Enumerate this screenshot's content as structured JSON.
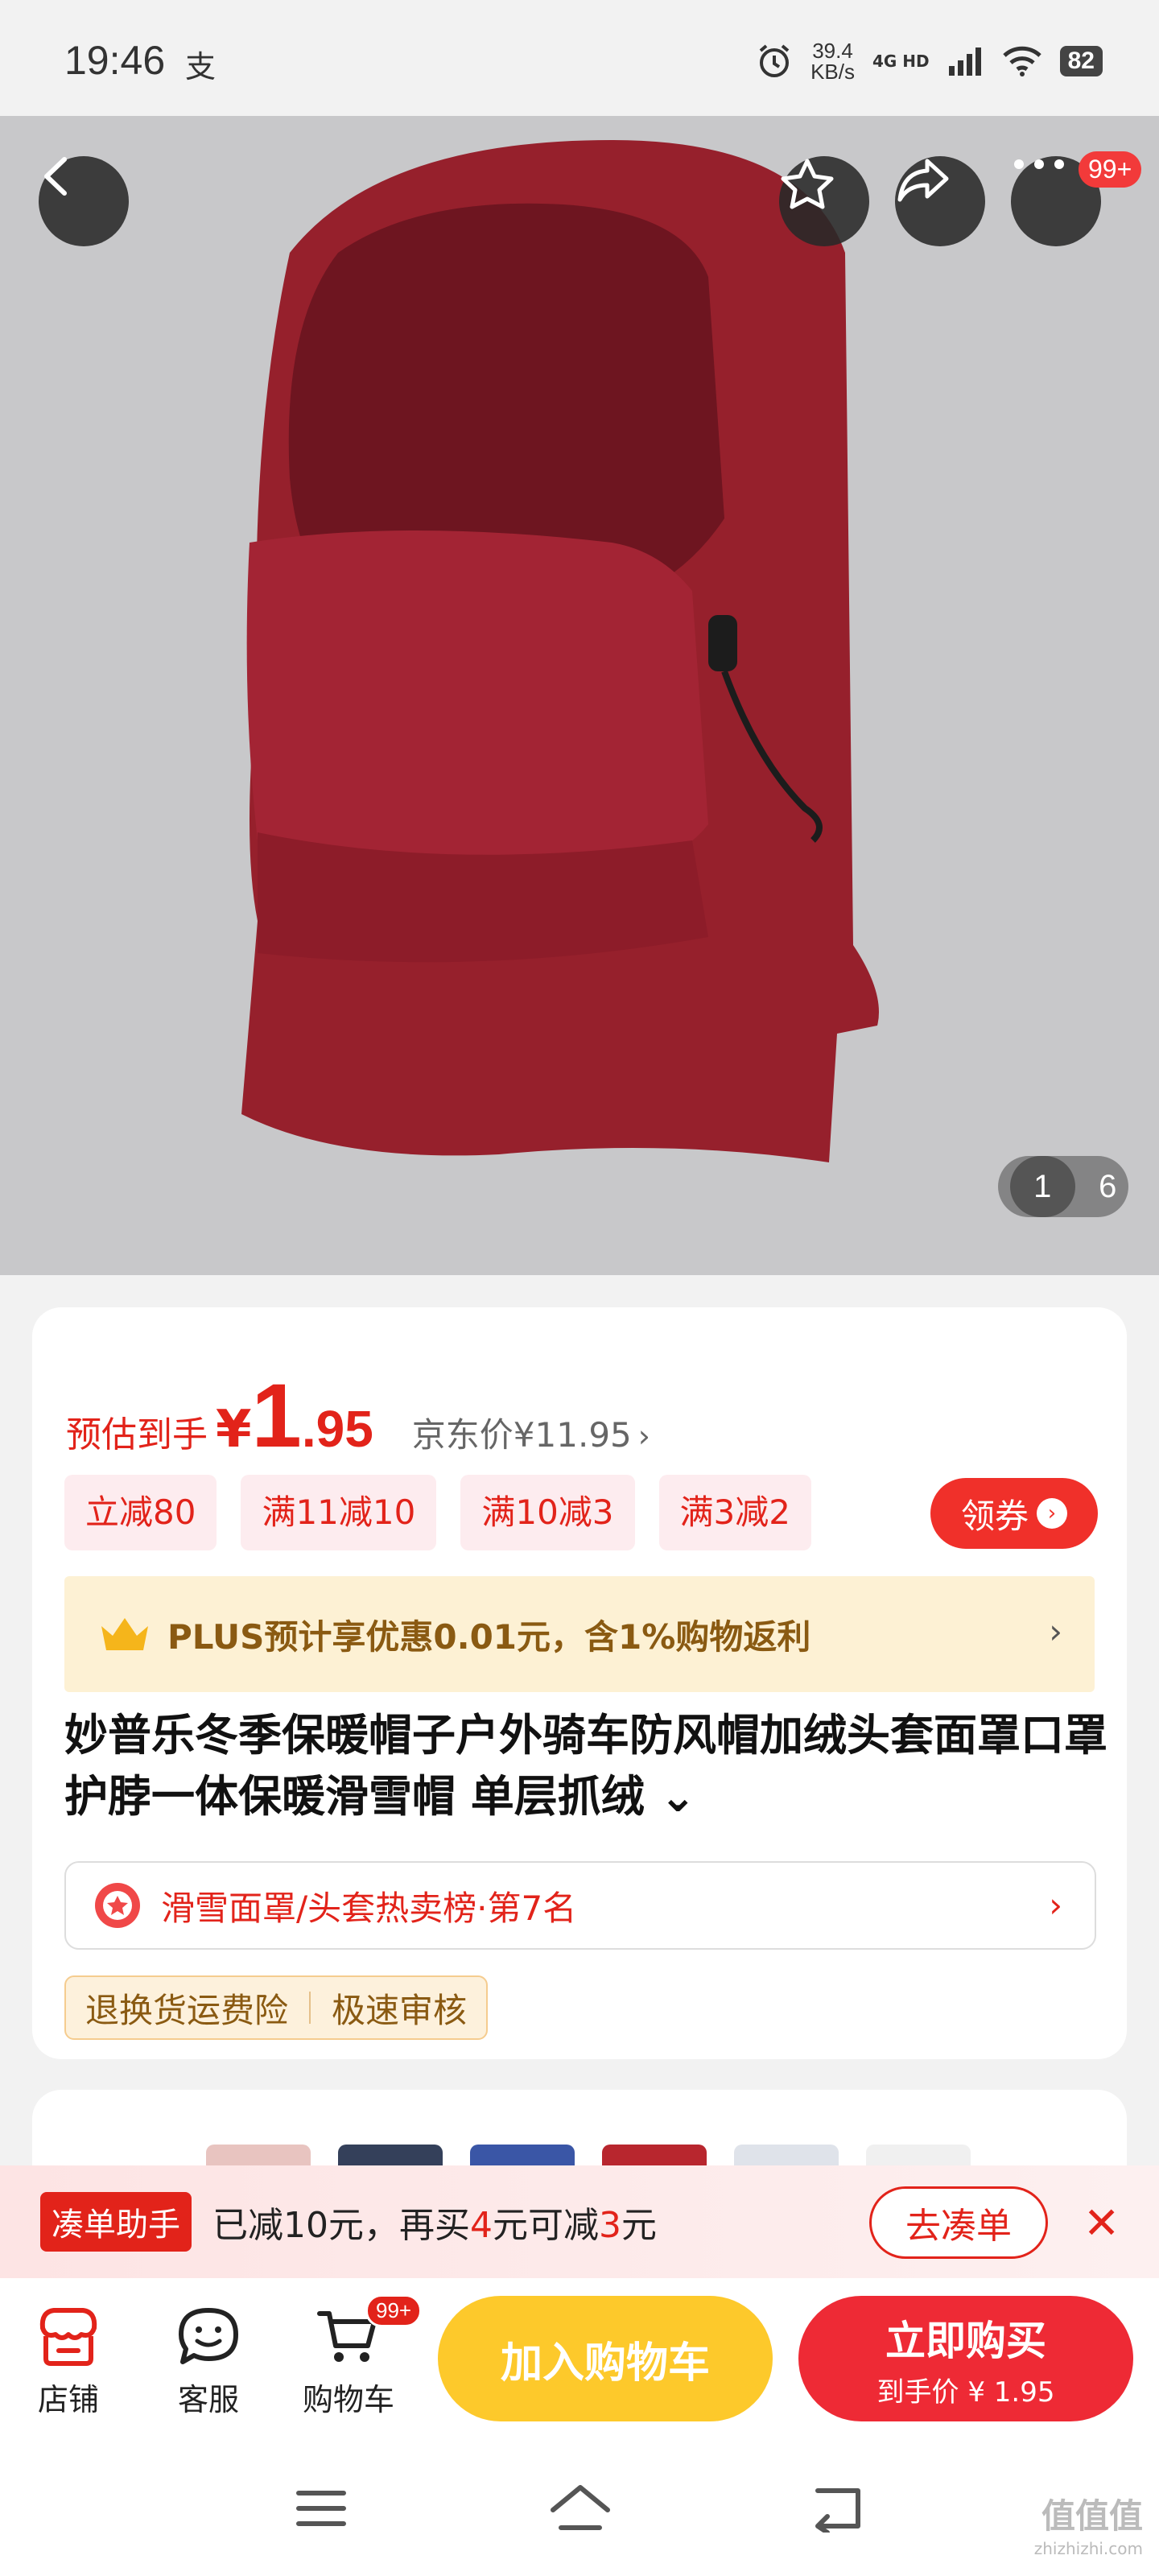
{
  "status_bar": {
    "time": "19:46",
    "alipay_glyph": "支",
    "speed_value": "39.4",
    "speed_unit": "KB/s",
    "network": "4G HD",
    "battery": "82"
  },
  "gallery": {
    "current": "1",
    "total": "6",
    "more_badge": "99+",
    "icons": [
      "back-icon",
      "star-icon",
      "share-icon",
      "more-icon"
    ]
  },
  "product": {
    "est_label": "预估到手",
    "currency": "¥",
    "price_int": "1",
    "price_dec": ".95",
    "jd_price": "京东价¥11.95",
    "jd_arrow": "›",
    "coupons": [
      "立减80",
      "满11减10",
      "满10减3",
      "满3减2"
    ],
    "get_coupon_label": "领券",
    "plus_text": "PLUS预计享优惠0.01元，含1%购物返利",
    "title": "妙普乐冬季保暖帽子户外骑车防风帽加绒头套面罩口罩护脖一体保暖滑雪帽 单层抓绒 ⌄",
    "rank_text": "滑雪面罩/头套热卖榜·第7名",
    "tags": [
      "退换货运费险",
      "极速审核"
    ]
  },
  "helper_bar": {
    "badge": "凑单助手",
    "text_1": "已减10元，再买",
    "text_num1": "4",
    "text_2": "元可减",
    "text_num2": "3",
    "text_3": "元",
    "button": "去凑单",
    "close": "✕"
  },
  "action_bar": {
    "shop_label": "店铺",
    "service_label": "客服",
    "cart_label": "购物车",
    "cart_badge": "99+",
    "add_to_cart": "加入购物车",
    "buy_now": "立即购买",
    "buy_now_sub": "到手价 ¥ 1.95"
  },
  "watermark": {
    "main": "值值值",
    "sub": "zhizhizhi.com"
  },
  "colors": {
    "accent_red": "#e2231a",
    "cart_yellow": "#fdc92b",
    "buy_red": "#ee2a35",
    "plus_gold": "#8a5a12"
  }
}
